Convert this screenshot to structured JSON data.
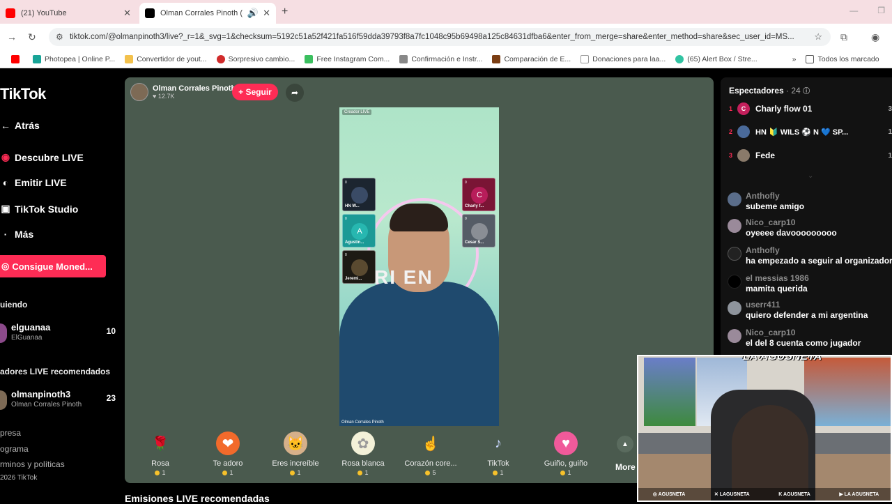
{
  "browser": {
    "tabs": [
      {
        "label": "(21) YouTube",
        "active": false
      },
      {
        "label": "Olman Corrales Pinoth (@o",
        "active": true
      }
    ],
    "url": "tiktok.com/@olmanpinoth3/live?_r=1&_svg=1&checksum=5192c51a52f421fa516f59dda39793f8a7fc1048c95b69498a125c84631dfba6&enter_from_merge=share&enter_method=share&sec_user_id=MS...",
    "bookmarks": [
      "Photopea | Online P...",
      "Convertidor de yout...",
      "Sorpresivo cambio...",
      "Free Instagram Com...",
      "Confirmación e Instr...",
      "Comparación de E...",
      "Donaciones para laa...",
      "(65) Alert Box / Stre...",
      "Todos los marcado"
    ],
    "more_bookmarks": "»"
  },
  "sidebar": {
    "logo": "TikTok",
    "nav": [
      {
        "label": "Atrás",
        "icon": "back-arrow-icon"
      },
      {
        "label": "Descubre LIVE",
        "icon": "live-icon"
      },
      {
        "label": "Emitir LIVE",
        "icon": "broadcast-icon"
      },
      {
        "label": "TikTok Studio",
        "icon": "studio-icon"
      },
      {
        "label": "Más",
        "icon": "more-icon"
      }
    ],
    "coins_button": "Consigue Moned...",
    "following_label": "uiendo",
    "following": {
      "name": "elguanaa",
      "sub": "ElGuanaa",
      "count": "10"
    },
    "recommended_label": "adores LIVE recomendados",
    "recommended": {
      "name": "olmanpinoth3",
      "sub": "Olman Corrales Pinoth",
      "count": "23"
    },
    "footer": [
      "presa",
      "ograma",
      "rminos y políticas",
      "2026 TikTok"
    ]
  },
  "player": {
    "host_name": "Olman Corrales Pinoth",
    "host_likes": "♥ 12.7K",
    "follow_label": "+ Seguir",
    "video": {
      "creador_label": "Creador LIVE",
      "overlay_text": "RI   EN",
      "caption": "Olman Corrales Pinoth",
      "guests": [
        {
          "name": "HN W...",
          "badge": "0"
        },
        {
          "name": "Agustin...",
          "badge": "0",
          "initial": "A"
        },
        {
          "name": "Jeremi...",
          "badge": "0"
        },
        {
          "name": "Charly f...",
          "badge": "0",
          "initial": "C"
        },
        {
          "name": "Cesar S...",
          "badge": "0"
        }
      ]
    },
    "gifts": [
      {
        "name": "Rosa",
        "price": "1"
      },
      {
        "name": "Te adoro",
        "price": "1"
      },
      {
        "name": "Eres increíble",
        "price": "1"
      },
      {
        "name": "Rosa blanca",
        "price": "1"
      },
      {
        "name": "Corazón core...",
        "price": "5"
      },
      {
        "name": "TikTok",
        "price": "1"
      },
      {
        "name": "Guiño, guiño",
        "price": "1"
      }
    ],
    "gifts_more": "More"
  },
  "recommended_title": "Emisiones LIVE recomendadas",
  "right_panel": {
    "viewers_title": "Espectadores",
    "viewers_count": "· 24",
    "viewers": [
      {
        "rank": "1",
        "name": "Charly flow 01",
        "initial": "C",
        "num": "3"
      },
      {
        "rank": "2",
        "name": "HN 🔰 WILS ⚽ N 💙 SP...",
        "initial": "",
        "num": "1"
      },
      {
        "rank": "3",
        "name": "Fede",
        "initial": "",
        "num": "1"
      }
    ],
    "chat": [
      {
        "user": "Anthofly",
        "msg": "subeme amigo"
      },
      {
        "user": "Nico_carp10",
        "msg": "oyeeee davooooooooo"
      },
      {
        "user": "Anthofly",
        "msg": " ha empezado a seguir al organizador"
      },
      {
        "user": "el messias 1986",
        "msg": "mamita querida"
      },
      {
        "user": "userr411",
        "msg": "quiero defender a mi argentina"
      },
      {
        "user": "Nico_carp10",
        "msg": "el    del 8 cuenta como jugador"
      }
    ]
  },
  "webcam": {
    "watermark": "LA AGUSNETA",
    "socials": [
      "AGUSNETA",
      "LAGUSNETA",
      "AGUSNETA",
      "LA AGUSNETA"
    ]
  },
  "colors": {
    "accent": "#fe2c55",
    "player_bg": "#4a5a4e",
    "panel_bg": "#121212"
  }
}
